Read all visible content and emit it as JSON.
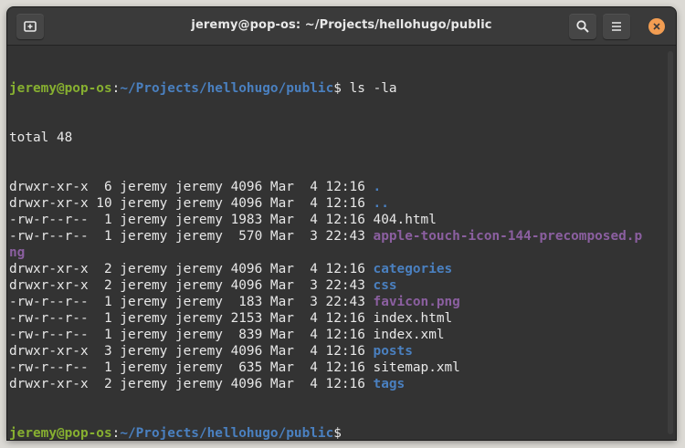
{
  "window": {
    "title": "jeremy@pop-os: ~/Projects/hellohugo/public",
    "accent": "#f29d52"
  },
  "toolbar": {
    "new_tab_icon": "new-tab-icon",
    "search_icon": "search-icon",
    "menu_icon": "hamburger-menu-icon",
    "close_icon": "close-icon"
  },
  "prompt": {
    "user": "jeremy@pop-os",
    "sep": ":",
    "path": "~/Projects/hellohugo/public",
    "dollar": "$",
    "command": " ls -la"
  },
  "output": {
    "total": "total 48",
    "rows": [
      {
        "meta": "drwxr-xr-x  6 jeremy jeremy 4096 Mar  4 12:16 ",
        "name": ".",
        "kind": "dir"
      },
      {
        "meta": "drwxr-xr-x 10 jeremy jeremy 4096 Mar  4 12:16 ",
        "name": "..",
        "kind": "dir"
      },
      {
        "meta": "-rw-r--r--  1 jeremy jeremy 1983 Mar  4 12:16 ",
        "name": "404.html",
        "kind": "file"
      },
      {
        "meta": "-rw-r--r--  1 jeremy jeremy  570 Mar  3 22:43 ",
        "name": "apple-touch-icon-144-precomposed.p",
        "name_wrap": "ng",
        "kind": "img"
      },
      {
        "meta": "drwxr-xr-x  2 jeremy jeremy 4096 Mar  4 12:16 ",
        "name": "categories",
        "kind": "dir"
      },
      {
        "meta": "drwxr-xr-x  2 jeremy jeremy 4096 Mar  3 22:43 ",
        "name": "css",
        "kind": "dir"
      },
      {
        "meta": "-rw-r--r--  1 jeremy jeremy  183 Mar  3 22:43 ",
        "name": "favicon.png",
        "kind": "img"
      },
      {
        "meta": "-rw-r--r--  1 jeremy jeremy 2153 Mar  4 12:16 ",
        "name": "index.html",
        "kind": "file"
      },
      {
        "meta": "-rw-r--r--  1 jeremy jeremy  839 Mar  4 12:16 ",
        "name": "index.xml",
        "kind": "file"
      },
      {
        "meta": "drwxr-xr-x  3 jeremy jeremy 4096 Mar  4 12:16 ",
        "name": "posts",
        "kind": "dir"
      },
      {
        "meta": "-rw-r--r--  1 jeremy jeremy  635 Mar  4 12:16 ",
        "name": "sitemap.xml",
        "kind": "file"
      },
      {
        "meta": "drwxr-xr-x  2 jeremy jeremy 4096 Mar  4 12:16 ",
        "name": "tags",
        "kind": "dir"
      }
    ]
  }
}
